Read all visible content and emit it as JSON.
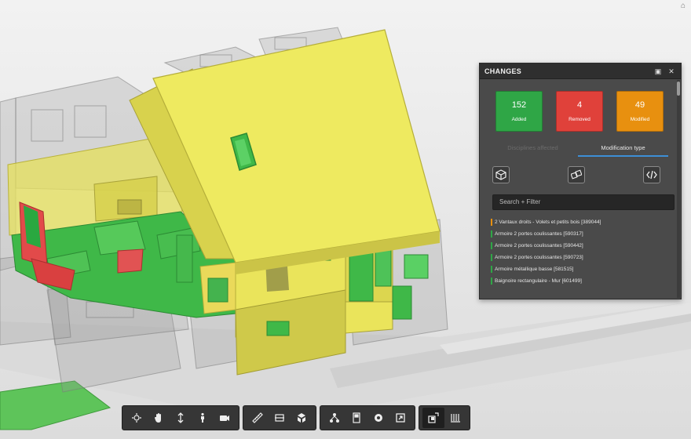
{
  "viewer": {
    "home_icon": "home-icon"
  },
  "panel": {
    "title": "CHANGES",
    "minimize_icon": "minimize-icon",
    "close_icon": "close-icon",
    "stats": [
      {
        "count": "152",
        "label": "Added",
        "color": "#2fa646"
      },
      {
        "count": "4",
        "label": "Removed",
        "color": "#e0413a"
      },
      {
        "count": "49",
        "label": "Modified",
        "color": "#e8900f"
      }
    ],
    "tabs": [
      {
        "label": "Disciplines affected",
        "active": false
      },
      {
        "label": "Modification type",
        "active": true
      }
    ],
    "filters": [
      "cube-icon",
      "linked-cubes-icon",
      "code-icon"
    ],
    "search_placeholder": "Search + Filter",
    "items": [
      {
        "label": "2 Vantaux droits - Volets et petits bois [389044]",
        "color": "#e8900f"
      },
      {
        "label": "Armoire 2 portes coulissantes [590317]",
        "color": "#2fa646"
      },
      {
        "label": "Armoire 2 portes coulissantes [590442]",
        "color": "#2fa646"
      },
      {
        "label": "Armoire 2 portes coulissantes [590723]",
        "color": "#2fa646"
      },
      {
        "label": "Armoire métallique basse [581515]",
        "color": "#2fa646"
      },
      {
        "label": "Baignoire rectangulaire - Mur [601499]",
        "color": "#2fa646"
      }
    ]
  },
  "toolbar": {
    "groups": [
      [
        "orbit-icon",
        "pan-icon",
        "zoom-icon",
        "walk-icon",
        "camera-icon"
      ],
      [
        "measure-icon",
        "section-icon",
        "explode-icon"
      ],
      [
        "model-tree-icon",
        "properties-icon",
        "settings-icon",
        "fullscreen-icon"
      ],
      [
        "changes-icon",
        "list-icon"
      ]
    ],
    "active": "changes-icon"
  }
}
